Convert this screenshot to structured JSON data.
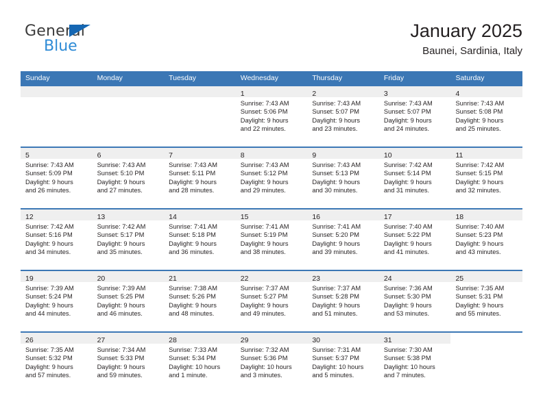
{
  "brand": {
    "line1": "General",
    "line2": "Blue",
    "triangle_color": "#1567b3",
    "line2_color": "#2e8bd6"
  },
  "header": {
    "title": "January 2025",
    "subtitle": "Baunei, Sardinia, Italy"
  },
  "theme": {
    "header_blue": "#3b77b5",
    "daynum_band": "#efefef",
    "text": "#231f20"
  },
  "weekdays": [
    "Sunday",
    "Monday",
    "Tuesday",
    "Wednesday",
    "Thursday",
    "Friday",
    "Saturday"
  ],
  "weeks": [
    [
      {
        "day": "",
        "lines": []
      },
      {
        "day": "",
        "lines": []
      },
      {
        "day": "",
        "lines": []
      },
      {
        "day": "1",
        "lines": [
          "Sunrise: 7:43 AM",
          "Sunset: 5:06 PM",
          "Daylight: 9 hours",
          "and 22 minutes."
        ]
      },
      {
        "day": "2",
        "lines": [
          "Sunrise: 7:43 AM",
          "Sunset: 5:07 PM",
          "Daylight: 9 hours",
          "and 23 minutes."
        ]
      },
      {
        "day": "3",
        "lines": [
          "Sunrise: 7:43 AM",
          "Sunset: 5:07 PM",
          "Daylight: 9 hours",
          "and 24 minutes."
        ]
      },
      {
        "day": "4",
        "lines": [
          "Sunrise: 7:43 AM",
          "Sunset: 5:08 PM",
          "Daylight: 9 hours",
          "and 25 minutes."
        ]
      }
    ],
    [
      {
        "day": "5",
        "lines": [
          "Sunrise: 7:43 AM",
          "Sunset: 5:09 PM",
          "Daylight: 9 hours",
          "and 26 minutes."
        ]
      },
      {
        "day": "6",
        "lines": [
          "Sunrise: 7:43 AM",
          "Sunset: 5:10 PM",
          "Daylight: 9 hours",
          "and 27 minutes."
        ]
      },
      {
        "day": "7",
        "lines": [
          "Sunrise: 7:43 AM",
          "Sunset: 5:11 PM",
          "Daylight: 9 hours",
          "and 28 minutes."
        ]
      },
      {
        "day": "8",
        "lines": [
          "Sunrise: 7:43 AM",
          "Sunset: 5:12 PM",
          "Daylight: 9 hours",
          "and 29 minutes."
        ]
      },
      {
        "day": "9",
        "lines": [
          "Sunrise: 7:43 AM",
          "Sunset: 5:13 PM",
          "Daylight: 9 hours",
          "and 30 minutes."
        ]
      },
      {
        "day": "10",
        "lines": [
          "Sunrise: 7:42 AM",
          "Sunset: 5:14 PM",
          "Daylight: 9 hours",
          "and 31 minutes."
        ]
      },
      {
        "day": "11",
        "lines": [
          "Sunrise: 7:42 AM",
          "Sunset: 5:15 PM",
          "Daylight: 9 hours",
          "and 32 minutes."
        ]
      }
    ],
    [
      {
        "day": "12",
        "lines": [
          "Sunrise: 7:42 AM",
          "Sunset: 5:16 PM",
          "Daylight: 9 hours",
          "and 34 minutes."
        ]
      },
      {
        "day": "13",
        "lines": [
          "Sunrise: 7:42 AM",
          "Sunset: 5:17 PM",
          "Daylight: 9 hours",
          "and 35 minutes."
        ]
      },
      {
        "day": "14",
        "lines": [
          "Sunrise: 7:41 AM",
          "Sunset: 5:18 PM",
          "Daylight: 9 hours",
          "and 36 minutes."
        ]
      },
      {
        "day": "15",
        "lines": [
          "Sunrise: 7:41 AM",
          "Sunset: 5:19 PM",
          "Daylight: 9 hours",
          "and 38 minutes."
        ]
      },
      {
        "day": "16",
        "lines": [
          "Sunrise: 7:41 AM",
          "Sunset: 5:20 PM",
          "Daylight: 9 hours",
          "and 39 minutes."
        ]
      },
      {
        "day": "17",
        "lines": [
          "Sunrise: 7:40 AM",
          "Sunset: 5:22 PM",
          "Daylight: 9 hours",
          "and 41 minutes."
        ]
      },
      {
        "day": "18",
        "lines": [
          "Sunrise: 7:40 AM",
          "Sunset: 5:23 PM",
          "Daylight: 9 hours",
          "and 43 minutes."
        ]
      }
    ],
    [
      {
        "day": "19",
        "lines": [
          "Sunrise: 7:39 AM",
          "Sunset: 5:24 PM",
          "Daylight: 9 hours",
          "and 44 minutes."
        ]
      },
      {
        "day": "20",
        "lines": [
          "Sunrise: 7:39 AM",
          "Sunset: 5:25 PM",
          "Daylight: 9 hours",
          "and 46 minutes."
        ]
      },
      {
        "day": "21",
        "lines": [
          "Sunrise: 7:38 AM",
          "Sunset: 5:26 PM",
          "Daylight: 9 hours",
          "and 48 minutes."
        ]
      },
      {
        "day": "22",
        "lines": [
          "Sunrise: 7:37 AM",
          "Sunset: 5:27 PM",
          "Daylight: 9 hours",
          "and 49 minutes."
        ]
      },
      {
        "day": "23",
        "lines": [
          "Sunrise: 7:37 AM",
          "Sunset: 5:28 PM",
          "Daylight: 9 hours",
          "and 51 minutes."
        ]
      },
      {
        "day": "24",
        "lines": [
          "Sunrise: 7:36 AM",
          "Sunset: 5:30 PM",
          "Daylight: 9 hours",
          "and 53 minutes."
        ]
      },
      {
        "day": "25",
        "lines": [
          "Sunrise: 7:35 AM",
          "Sunset: 5:31 PM",
          "Daylight: 9 hours",
          "and 55 minutes."
        ]
      }
    ],
    [
      {
        "day": "26",
        "lines": [
          "Sunrise: 7:35 AM",
          "Sunset: 5:32 PM",
          "Daylight: 9 hours",
          "and 57 minutes."
        ]
      },
      {
        "day": "27",
        "lines": [
          "Sunrise: 7:34 AM",
          "Sunset: 5:33 PM",
          "Daylight: 9 hours",
          "and 59 minutes."
        ]
      },
      {
        "day": "28",
        "lines": [
          "Sunrise: 7:33 AM",
          "Sunset: 5:34 PM",
          "Daylight: 10 hours",
          "and 1 minute."
        ]
      },
      {
        "day": "29",
        "lines": [
          "Sunrise: 7:32 AM",
          "Sunset: 5:36 PM",
          "Daylight: 10 hours",
          "and 3 minutes."
        ]
      },
      {
        "day": "30",
        "lines": [
          "Sunrise: 7:31 AM",
          "Sunset: 5:37 PM",
          "Daylight: 10 hours",
          "and 5 minutes."
        ]
      },
      {
        "day": "31",
        "lines": [
          "Sunrise: 7:30 AM",
          "Sunset: 5:38 PM",
          "Daylight: 10 hours",
          "and 7 minutes."
        ]
      },
      {
        "day": "",
        "lines": []
      }
    ]
  ]
}
